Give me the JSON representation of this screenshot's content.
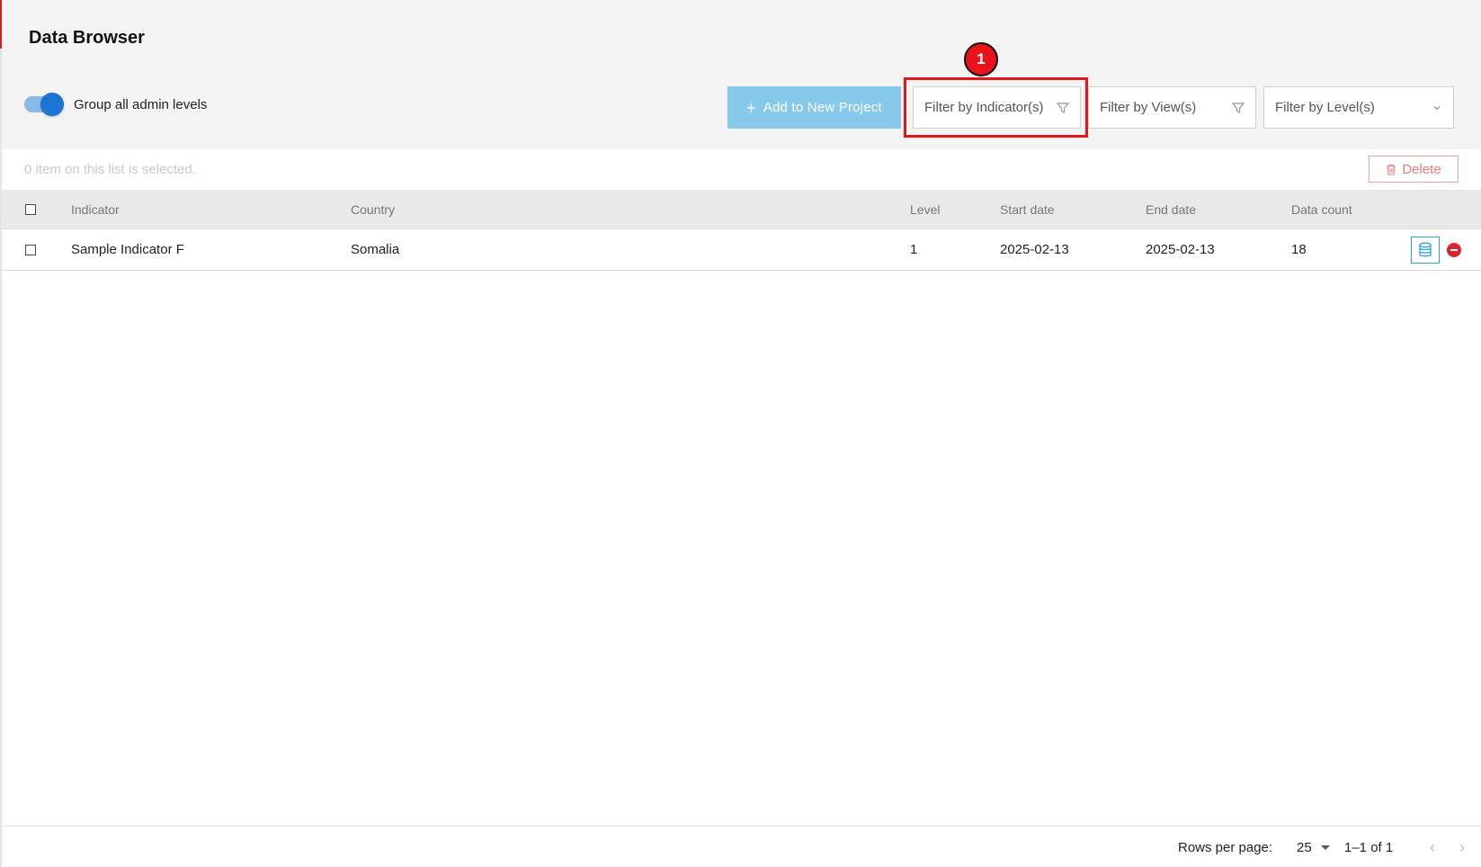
{
  "page": {
    "title": "Data Browser"
  },
  "toolbar": {
    "group_toggle_label": "Group all admin levels",
    "group_toggle_on": true,
    "add_button_label": "Add to New Project",
    "filter_indicator_placeholder": "Filter by Indicator(s)",
    "filter_view_placeholder": "Filter by View(s)",
    "filter_level_placeholder": "Filter by Level(s)"
  },
  "annotation": {
    "step_number": "1"
  },
  "selection": {
    "text": "0 item on this list is selected.",
    "delete_label": "Delete"
  },
  "table": {
    "columns": [
      "Indicator",
      "Country",
      "Level",
      "Start date",
      "End date",
      "Data count"
    ],
    "rows": [
      {
        "indicator": "Sample Indicator F",
        "country": "Somalia",
        "level": "1",
        "start_date": "2025-02-13",
        "end_date": "2025-02-13",
        "data_count": "18"
      }
    ]
  },
  "pagination": {
    "rows_per_page_label": "Rows per page:",
    "rows_per_page_value": "25",
    "range": "1–1 of 1"
  },
  "colors": {
    "accent_blue": "#1e74d2",
    "add_button": "#87c9ea",
    "highlight_red": "#e8131b",
    "delete_red": "#ee7b7b"
  }
}
